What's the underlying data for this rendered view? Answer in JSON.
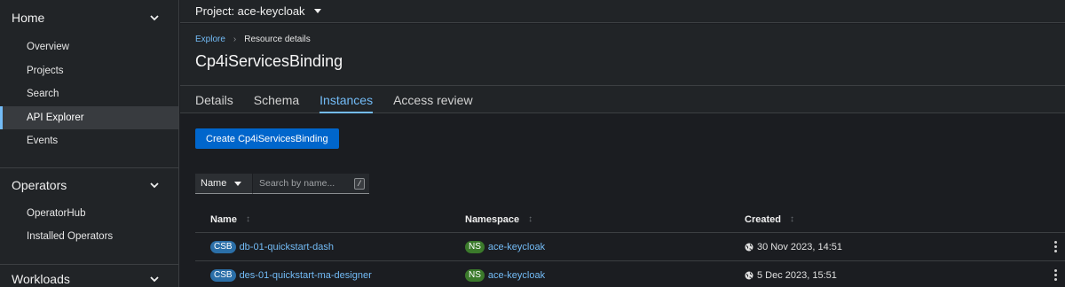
{
  "sidebar": {
    "sections": [
      {
        "label": "Home",
        "items": [
          "Overview",
          "Projects",
          "Search",
          "API Explorer",
          "Events"
        ]
      },
      {
        "label": "Operators",
        "items": [
          "OperatorHub",
          "Installed Operators"
        ]
      },
      {
        "label": "Workloads",
        "items": []
      }
    ],
    "active_item": "API Explorer"
  },
  "topbar": {
    "project_label": "Project: ace-keycloak"
  },
  "breadcrumb": {
    "parent": "Explore",
    "current": "Resource details"
  },
  "page": {
    "title": "Cp4iServicesBinding"
  },
  "tabs": [
    "Details",
    "Schema",
    "Instances",
    "Access review"
  ],
  "active_tab": "Instances",
  "create_button": "Create Cp4iServicesBinding",
  "filter": {
    "select_value": "Name",
    "placeholder": "Search by name...",
    "shortcut": "/"
  },
  "table": {
    "columns": [
      "Name",
      "Namespace",
      "Created"
    ],
    "rows": [
      {
        "kind_badge": "CSB",
        "name": "db-01-quickstart-dash",
        "ns_badge": "NS",
        "namespace": "ace-keycloak",
        "created": "30 Nov 2023, 14:51"
      },
      {
        "kind_badge": "CSB",
        "name": "des-01-quickstart-ma-designer",
        "ns_badge": "NS",
        "namespace": "ace-keycloak",
        "created": "5 Dec 2023, 15:51"
      }
    ]
  },
  "colors": {
    "accent": "#73bcf7",
    "primary_button": "#0066cc",
    "csb_badge": "#2b6fa8",
    "ns_badge": "#3b7a2b"
  }
}
